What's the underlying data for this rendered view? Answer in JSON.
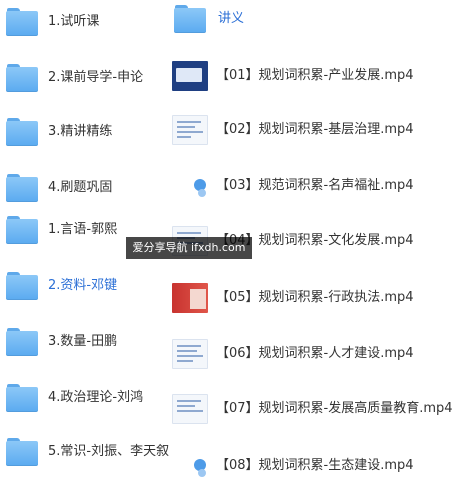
{
  "left_folders": [
    {
      "label": "1.试听课"
    },
    {
      "label": "2.课前导学-申论"
    },
    {
      "label": "3.精讲精练"
    },
    {
      "label": "4.刷题巩固"
    },
    {
      "label": "1.言语-郭熙"
    },
    {
      "label": "2.资料-邓键",
      "highlight": true
    },
    {
      "label": "3.数量-田鹏"
    },
    {
      "label": "4.政治理论-刘鸿"
    },
    {
      "label": "5.常识-刘振、李天叙"
    }
  ],
  "right_items": [
    {
      "label": "讲义",
      "type": "folder"
    },
    {
      "label": "【01】规划词积累-产业发展.mp4",
      "thumb": "dark"
    },
    {
      "label": "【02】规划词积累-基层治理.mp4",
      "thumb": "doc"
    },
    {
      "label": "【03】规范词积累-名声福祉.mp4",
      "thumb": "icon"
    },
    {
      "label": "【04】规划词积累-文化发展.mp4",
      "thumb": "doc"
    },
    {
      "label": "【05】规划词积累-行政执法.mp4",
      "thumb": "red"
    },
    {
      "label": "【06】规划词积累-人才建设.mp4",
      "thumb": "doc"
    },
    {
      "label": "【07】规划词积累-发展高质量教育.mp4",
      "thumb": "doc"
    },
    {
      "label": "【08】规划词积累-生态建设.mp4",
      "thumb": "icon"
    }
  ],
  "watermark": "爱分享导航 ifxdh.com"
}
